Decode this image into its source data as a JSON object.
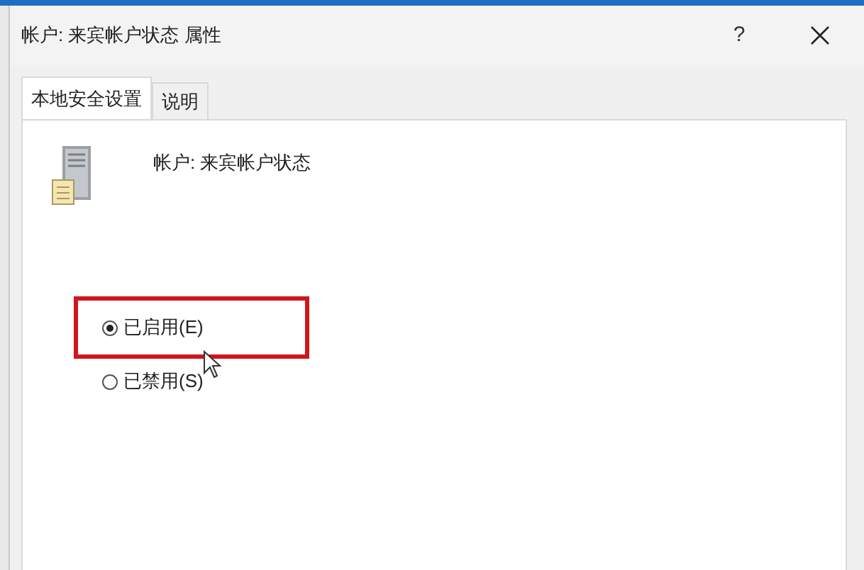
{
  "window": {
    "title": "帐户: 来宾帐户状态 属性",
    "help": "?"
  },
  "tabs": [
    {
      "label": "本地安全设置",
      "selected": true
    },
    {
      "label": "说明",
      "selected": false
    }
  ],
  "policy_name": "帐户: 来宾帐户状态",
  "options": [
    {
      "label": "已启用(E)",
      "selected": true,
      "highlighted": true
    },
    {
      "label": "已禁用(S)",
      "selected": false,
      "highlighted": false
    }
  ]
}
